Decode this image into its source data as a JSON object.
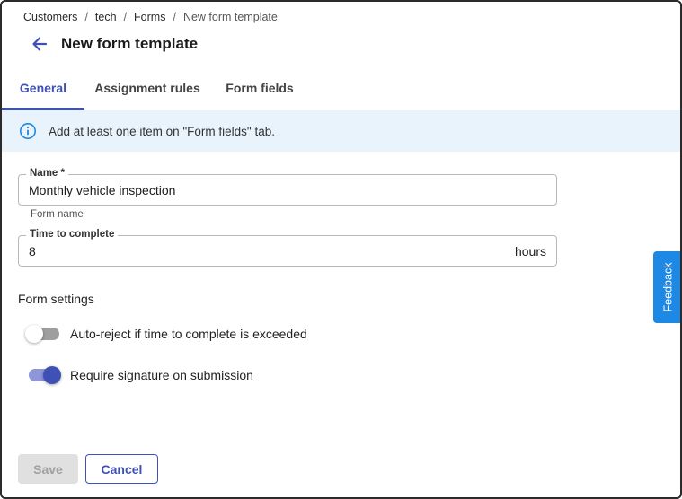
{
  "breadcrumb": {
    "items": [
      "Customers",
      "tech",
      "Forms",
      "New form template"
    ],
    "separator": "/"
  },
  "header": {
    "title": "New form template",
    "back_icon": "arrow-left-icon"
  },
  "tabs": [
    {
      "label": "General",
      "active": true
    },
    {
      "label": "Assignment rules",
      "active": false
    },
    {
      "label": "Form fields",
      "active": false
    }
  ],
  "banner": {
    "icon": "info-icon",
    "text": "Add at least one item on \"Form fields\" tab."
  },
  "form": {
    "name": {
      "label": "Name *",
      "value": "Monthly vehicle inspection",
      "helper": "Form name"
    },
    "time": {
      "label": "Time to complete",
      "value": "8",
      "suffix": "hours"
    },
    "settings_label": "Form settings",
    "toggles": [
      {
        "label": "Auto-reject if time to complete is exceeded",
        "on": false
      },
      {
        "label": "Require signature on submission",
        "on": true
      }
    ]
  },
  "actions": {
    "save_label": "Save",
    "save_disabled": true,
    "cancel_label": "Cancel"
  },
  "feedback": {
    "label": "Feedback"
  },
  "colors": {
    "accent": "#3f51b5",
    "banner_bg": "#e9f3fb",
    "feedback_bg": "#1e88e5"
  }
}
